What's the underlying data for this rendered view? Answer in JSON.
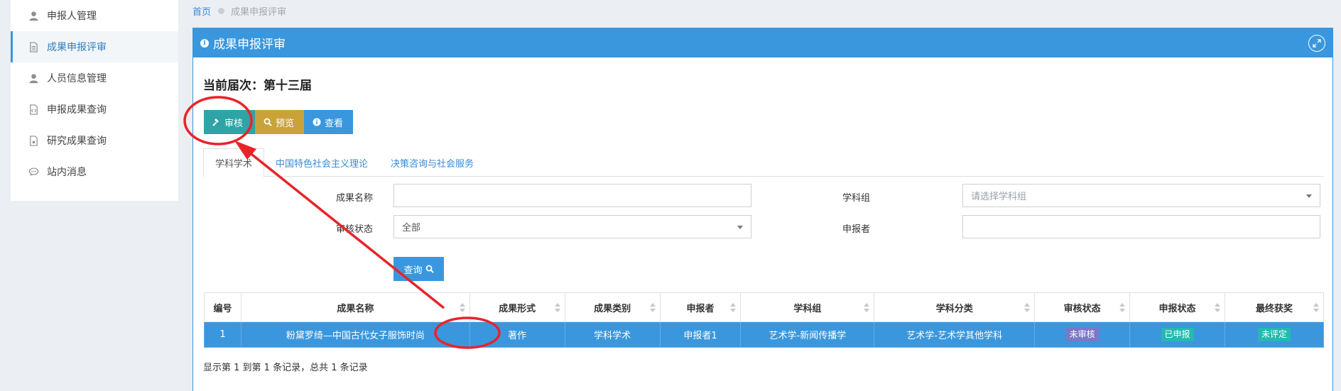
{
  "sidebar": {
    "items": [
      {
        "label": "申报人管理",
        "icon": "user-icon"
      },
      {
        "label": "成果申报评审",
        "icon": "document-icon",
        "active": true
      },
      {
        "label": "人员信息管理",
        "icon": "user-icon"
      },
      {
        "label": "申报成果查询",
        "icon": "code-file-icon"
      },
      {
        "label": "研究成果查询",
        "icon": "file-icon"
      },
      {
        "label": "站内消息",
        "icon": "chat-icon"
      }
    ]
  },
  "breadcrumb": {
    "home": "首页",
    "current": "成果申报评审"
  },
  "panel": {
    "title": "成果申报评审"
  },
  "session": {
    "label": "当前届次：第十三届"
  },
  "toolbar": {
    "audit_label": "审核",
    "preview_label": "预览",
    "view_label": "查看"
  },
  "tabs": [
    {
      "label": "学科学术",
      "active": true
    },
    {
      "label": "中国特色社会主义理论"
    },
    {
      "label": "决策咨询与社会服务"
    }
  ],
  "form": {
    "name_label": "成果名称",
    "name_value": "",
    "group_label": "学科组",
    "group_placeholder": "请选择学科组",
    "status_label": "审核状态",
    "status_value": "全部",
    "applicant_label": "申报者",
    "applicant_value": "",
    "query_label": "查询"
  },
  "table": {
    "headers": [
      "编号",
      "成果名称",
      "成果形式",
      "成果类别",
      "申报者",
      "学科组",
      "学科分类",
      "审核状态",
      "申报状态",
      "最终获奖"
    ],
    "rows": [
      [
        "1",
        "粉黛罗绮—中国古代女子服饰时尚",
        "著作",
        "学科学术",
        "申报者1",
        "艺术学-新闻传播学",
        "艺术学-艺术学其他学科",
        "未审核",
        "已申报",
        "未评定"
      ]
    ]
  },
  "pagination": {
    "info": "显示第 1 到第 1 条记录，总共 1 条记录"
  },
  "colors": {
    "primary": "#3a97dd",
    "audit": "#2ea4a6",
    "preview": "#c9a33a",
    "annotation": "#e8242a"
  }
}
